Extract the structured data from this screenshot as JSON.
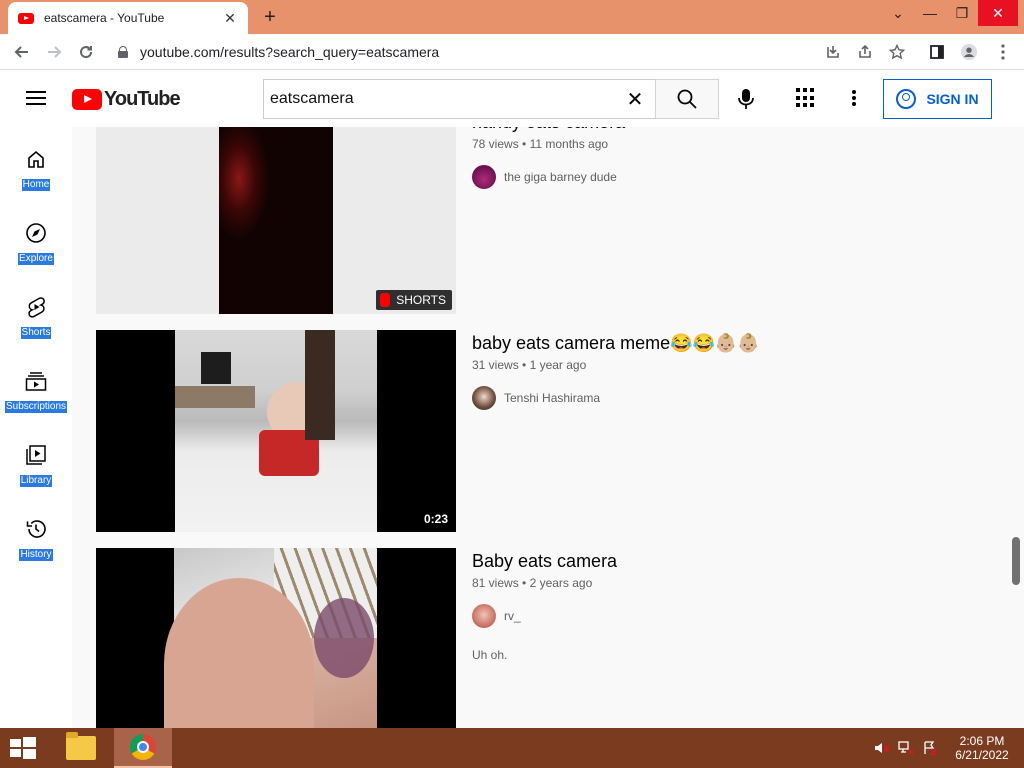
{
  "browser": {
    "tab_title": "eatscamera - YouTube",
    "tab_close": "✕",
    "new_tab": "+",
    "url": "youtube.com/results?search_query=eatscamera",
    "window_controls": [
      "⌄",
      "—",
      "❐",
      "✕"
    ]
  },
  "masthead": {
    "logo_text": "YouTube",
    "search_value": "eatscamera",
    "clear_glyph": "✕",
    "signin_label": "SIGN IN"
  },
  "guide": {
    "items": [
      {
        "label": "Home",
        "icon": "home-icon"
      },
      {
        "label": "Explore",
        "icon": "compass-icon"
      },
      {
        "label": "Shorts",
        "icon": "shorts-icon"
      },
      {
        "label": "Subscriptions",
        "icon": "subscriptions-icon"
      },
      {
        "label": "Library",
        "icon": "library-icon"
      },
      {
        "label": "History",
        "icon": "history-icon"
      }
    ]
  },
  "results": [
    {
      "title": "handy eats camera",
      "views": "78 views",
      "age": "11 months ago",
      "channel": "the giga barney dude",
      "badge": "SHORTS",
      "description": ""
    },
    {
      "title": "baby eats camera meme😂😂👶🏼👶🏼",
      "views": "31 views",
      "age": "1 year ago",
      "channel": "Tenshi Hashirama",
      "badge": "0:23",
      "description": ""
    },
    {
      "title": "Baby eats camera",
      "views": "81 views",
      "age": "2 years ago",
      "channel": "rv_",
      "badge": "",
      "description": "Uh oh."
    }
  ],
  "taskbar": {
    "time": "2:06 PM",
    "date": "6/21/2022"
  },
  "colors": {
    "titlebar": "#e8926b",
    "taskbar": "#7a3b1f",
    "accent_blue": "#065fd4",
    "yt_red": "#ff0000"
  }
}
